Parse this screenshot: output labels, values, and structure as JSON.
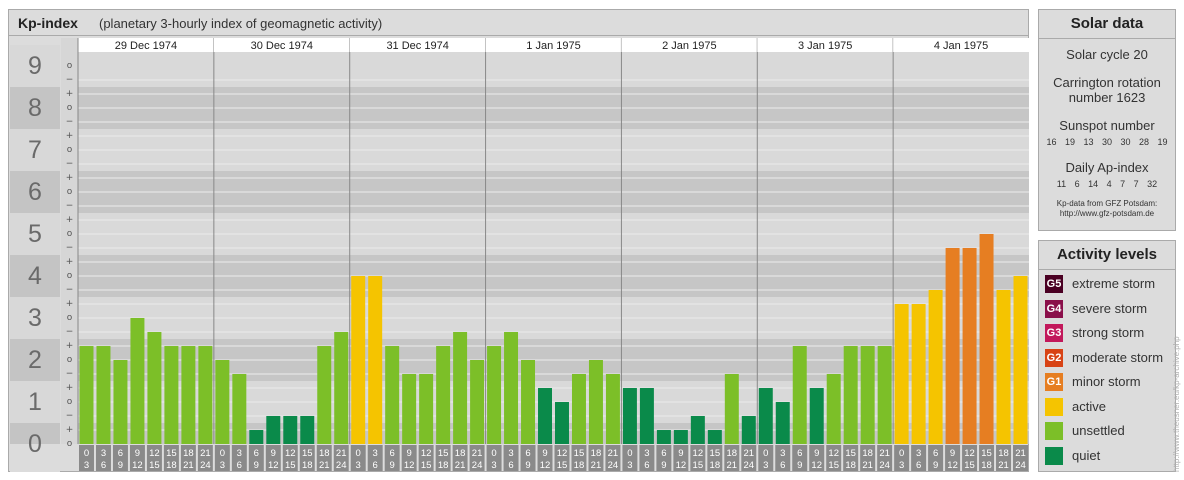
{
  "title": "Kp-index",
  "subtitle": "(planetary 3-hourly index of geomagnetic activity)",
  "chart_data": {
    "type": "bar",
    "ylim": [
      0,
      9
    ],
    "y_major_labels": [
      "0",
      "1",
      "2",
      "3",
      "4",
      "5",
      "6",
      "7",
      "8",
      "9"
    ],
    "y_minor_labels": [
      "o",
      "+",
      "−",
      "o",
      "+",
      "−",
      "o",
      "+",
      "−",
      "o",
      "+",
      "−",
      "o",
      "+",
      "−",
      "o",
      "+",
      "−",
      "o",
      "+",
      "−",
      "o",
      "+",
      "−",
      "o",
      "+",
      "−",
      "o"
    ],
    "hour_start": [
      "0",
      "3",
      "6",
      "9",
      "12",
      "15",
      "18",
      "21"
    ],
    "hour_end": [
      "3",
      "6",
      "9",
      "12",
      "15",
      "18",
      "21",
      "24"
    ],
    "days": [
      {
        "date": "29 Dec 1974",
        "values": [
          2.333,
          2.333,
          2.0,
          3.0,
          2.667,
          2.333,
          2.333,
          2.333
        ]
      },
      {
        "date": "30 Dec 1974",
        "values": [
          2.0,
          1.667,
          0.333,
          0.667,
          0.667,
          0.667,
          2.333,
          2.667
        ]
      },
      {
        "date": "31 Dec 1974",
        "values": [
          4.0,
          4.0,
          2.333,
          1.667,
          1.667,
          2.333,
          2.667,
          2.0
        ]
      },
      {
        "date": "1 Jan 1975",
        "values": [
          2.333,
          2.667,
          2.0,
          1.333,
          1.0,
          1.667,
          2.0,
          1.667
        ]
      },
      {
        "date": "2 Jan 1975",
        "values": [
          1.333,
          1.333,
          0.333,
          0.333,
          0.667,
          0.333,
          1.667,
          0.667
        ]
      },
      {
        "date": "3 Jan 1975",
        "values": [
          1.333,
          1.0,
          2.333,
          1.333,
          1.667,
          2.333,
          2.333,
          2.333
        ]
      },
      {
        "date": "4 Jan 1975",
        "values": [
          3.333,
          3.333,
          3.667,
          4.667,
          4.667,
          5.0,
          3.667,
          4.0
        ]
      }
    ],
    "color_thresholds": [
      {
        "min": 9.0,
        "level": "extreme storm",
        "color": "#4a0023"
      },
      {
        "min": 8.0,
        "level": "severe storm",
        "color": "#8a0f4a"
      },
      {
        "min": 7.0,
        "level": "strong storm",
        "color": "#c2185b"
      },
      {
        "min": 6.0,
        "level": "moderate storm",
        "color": "#d84315"
      },
      {
        "min": 4.667,
        "level": "minor storm",
        "color": "#e67e22"
      },
      {
        "min": 3.333,
        "level": "active",
        "color": "#f5c400"
      },
      {
        "min": 1.667,
        "level": "unsettled",
        "color": "#7cbf28"
      },
      {
        "min": 0.0,
        "level": "quiet",
        "color": "#0a8a4a"
      }
    ]
  },
  "solar": {
    "heading": "Solar data",
    "cycle": "Solar cycle 20",
    "carrington": "Carrington rotation number 1623",
    "sunspot_heading": "Sunspot number",
    "sunspot_values": "16 19 13 30 30 28 19",
    "ap_heading": "Daily Ap-index",
    "ap_values": "11 6 14 4 7 7 32",
    "credit_1": "Kp-data from GFZ Potsdam:",
    "credit_2": "http://www.gfz-potsdam.de"
  },
  "legend": {
    "heading": "Activity levels",
    "items": [
      {
        "badge": "G5",
        "label": "extreme storm",
        "color": "#4a0023"
      },
      {
        "badge": "G4",
        "label": "severe storm",
        "color": "#8a0f4a"
      },
      {
        "badge": "G3",
        "label": "strong storm",
        "color": "#c2185b"
      },
      {
        "badge": "G2",
        "label": "moderate storm",
        "color": "#d84315"
      },
      {
        "badge": "G1",
        "label": "minor storm",
        "color": "#e67e22"
      },
      {
        "badge": "",
        "label": "active",
        "color": "#f5c400"
      },
      {
        "badge": "",
        "label": "unsettled",
        "color": "#7cbf28"
      },
      {
        "badge": "",
        "label": "quiet",
        "color": "#0a8a4a"
      }
    ]
  },
  "watermark": "http://www.theusner.eu/kp-archive.php"
}
